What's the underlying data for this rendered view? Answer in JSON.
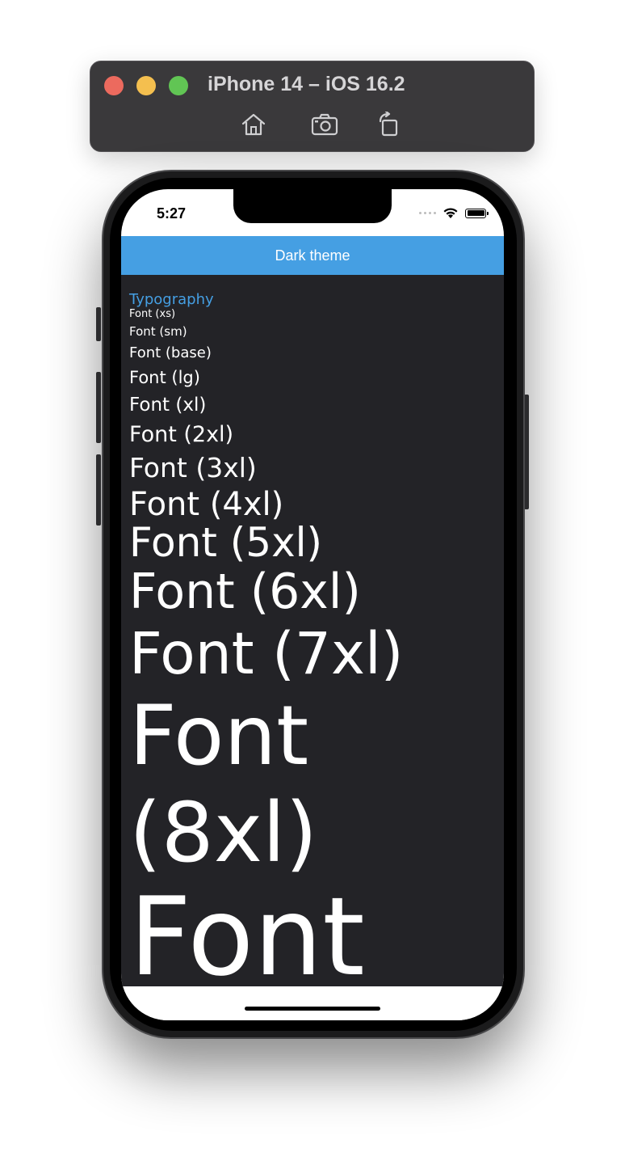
{
  "simulator": {
    "title": "iPhone 14 – iOS 16.2",
    "toolbar_buttons": [
      {
        "name": "home-icon"
      },
      {
        "name": "camera-icon"
      },
      {
        "name": "rotate-icon"
      }
    ]
  },
  "status_bar": {
    "time": "5:27"
  },
  "app": {
    "header_title": "Dark theme",
    "section_title": "Typography",
    "samples": [
      {
        "label": "Font (xs)"
      },
      {
        "label": "Font (sm)"
      },
      {
        "label": "Font (base)"
      },
      {
        "label": "Font (lg)"
      },
      {
        "label": "Font (xl)"
      },
      {
        "label": "Font (2xl)"
      },
      {
        "label": "Font (3xl)"
      },
      {
        "label": "Font (4xl)"
      },
      {
        "label": "Font (5xl)"
      },
      {
        "label": "Font (6xl)"
      },
      {
        "label": "Font (7xl)"
      },
      {
        "label": "Font"
      },
      {
        "label": "(8xl)"
      },
      {
        "label": "Font"
      }
    ]
  },
  "colors": {
    "header": "#459fe3",
    "background": "#232327",
    "text": "#ffffff",
    "accent": "#459fe3"
  }
}
